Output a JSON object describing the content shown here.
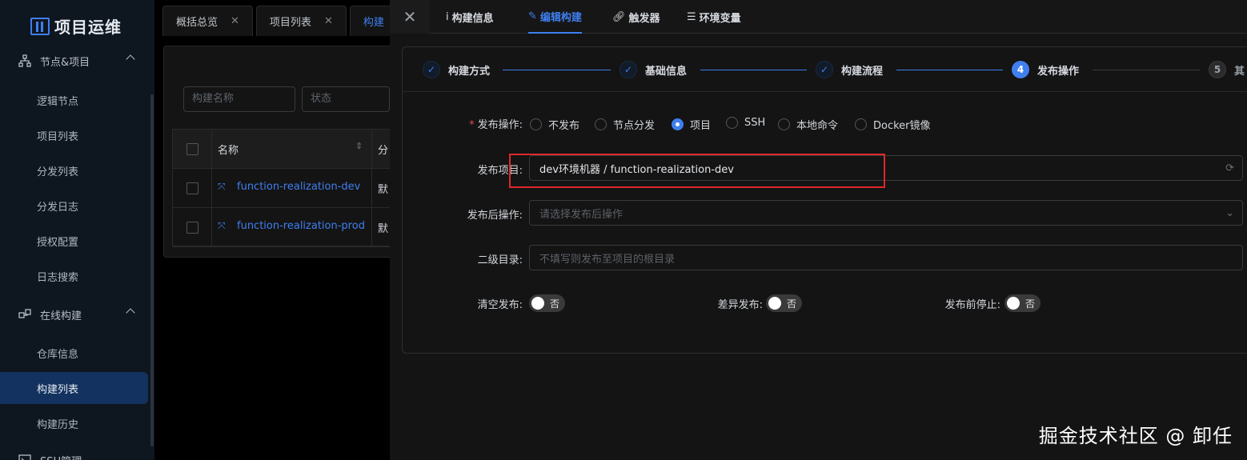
{
  "sidebar": {
    "logo": "项目运维",
    "groups": [
      {
        "label": "节点&项目",
        "icon": "sitemap-icon"
      },
      {
        "label": "在线构建",
        "icon": "build-icon"
      },
      {
        "label": "SSH管理",
        "icon": "terminal-icon"
      }
    ],
    "items": [
      "逻辑节点",
      "项目列表",
      "分发列表",
      "分发日志",
      "授权配置",
      "日志搜索",
      "仓库信息",
      "构建列表",
      "构建历史"
    ],
    "active_item": "构建列表"
  },
  "tabs": [
    {
      "label": "概括总览"
    },
    {
      "label": "项目列表"
    },
    {
      "label": "构建"
    }
  ],
  "filters": {
    "name_placeholder": "构建名称",
    "status_placeholder": "状态"
  },
  "table": {
    "headers": [
      "名称",
      "分"
    ],
    "rows": [
      {
        "name": "function-realization-dev",
        "col2": "默"
      },
      {
        "name": "function-realization-prod",
        "col2": "默"
      }
    ]
  },
  "drawer": {
    "tabs": [
      {
        "label": "构建信息",
        "icon": "info-icon"
      },
      {
        "label": "编辑构建",
        "icon": "edit-icon"
      },
      {
        "label": "触发器",
        "icon": "link-icon"
      },
      {
        "label": "环境变量",
        "icon": "list-icon"
      }
    ],
    "active_tab": "编辑构建",
    "steps": [
      {
        "label": "构建方式",
        "state": "done"
      },
      {
        "label": "基础信息",
        "state": "done"
      },
      {
        "label": "构建流程",
        "state": "done"
      },
      {
        "label": "发布操作",
        "state": "current",
        "num": "4"
      },
      {
        "label": "其",
        "state": "wait",
        "num": "5"
      }
    ],
    "form": {
      "publish_label": "发布操作:",
      "publish_options": [
        "不发布",
        "节点分发",
        "项目",
        "SSH",
        "本地命令",
        "Docker镜像"
      ],
      "publish_selected": "项目",
      "project_label": "发布项目:",
      "project_value": "dev环境机器 / function-realization-dev",
      "after_label": "发布后操作:",
      "after_placeholder": "请选择发布后操作",
      "subdir_label": "二级目录:",
      "subdir_placeholder": "不填写则发布至项目的根目录",
      "switches": [
        {
          "label": "清空发布:",
          "value": "否"
        },
        {
          "label": "差异发布:",
          "value": "否"
        },
        {
          "label": "发布前停止:",
          "value": "否"
        }
      ]
    }
  },
  "watermark": "掘金技术社区 @ 卸任",
  "colors": {
    "accent": "#3f7ff0",
    "highlight": "#e0272a",
    "sidebar_bg": "#0e1620"
  }
}
